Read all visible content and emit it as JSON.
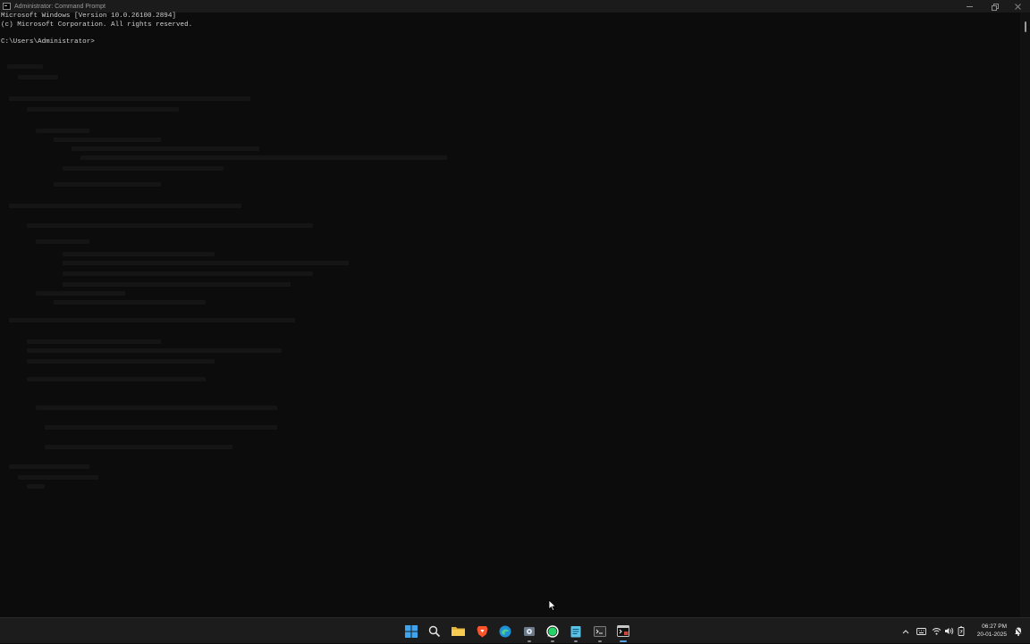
{
  "window": {
    "title": "Administrator: Command Prompt",
    "controls": {
      "minimize": "minimize",
      "maximize": "restore",
      "close": "close"
    }
  },
  "console": {
    "lines": [
      "Microsoft Windows [Version 10.0.26100.2894]",
      "(c) Microsoft Corporation. All rights reserved.",
      "",
      "C:\\Users\\Administrator>"
    ]
  },
  "taskbar": {
    "apps": [
      {
        "name": "start",
        "icon": "windows-start-icon",
        "running": false
      },
      {
        "name": "search",
        "icon": "search-icon",
        "running": false
      },
      {
        "name": "file-explorer",
        "icon": "folder-icon",
        "running": false
      },
      {
        "name": "brave",
        "icon": "brave-browser-icon",
        "running": false
      },
      {
        "name": "edge",
        "icon": "edge-browser-icon",
        "running": false
      },
      {
        "name": "app",
        "icon": "gear-app-icon",
        "running": true
      },
      {
        "name": "whatsapp",
        "icon": "whatsapp-icon",
        "running": true
      },
      {
        "name": "notepad",
        "icon": "notepad-icon",
        "running": true
      },
      {
        "name": "terminal",
        "icon": "terminal-icon",
        "running": true
      },
      {
        "name": "command-prompt",
        "icon": "cmd-icon",
        "running": true,
        "active": true
      }
    ],
    "tray": {
      "time": "06:27 PM",
      "date": "20-01-2025"
    }
  },
  "colors": {
    "console_bg": "#0c0c0c",
    "console_text": "#d0d0d0",
    "taskbar_bg": "#1c1c1c",
    "accent": "#5aa0e6"
  }
}
